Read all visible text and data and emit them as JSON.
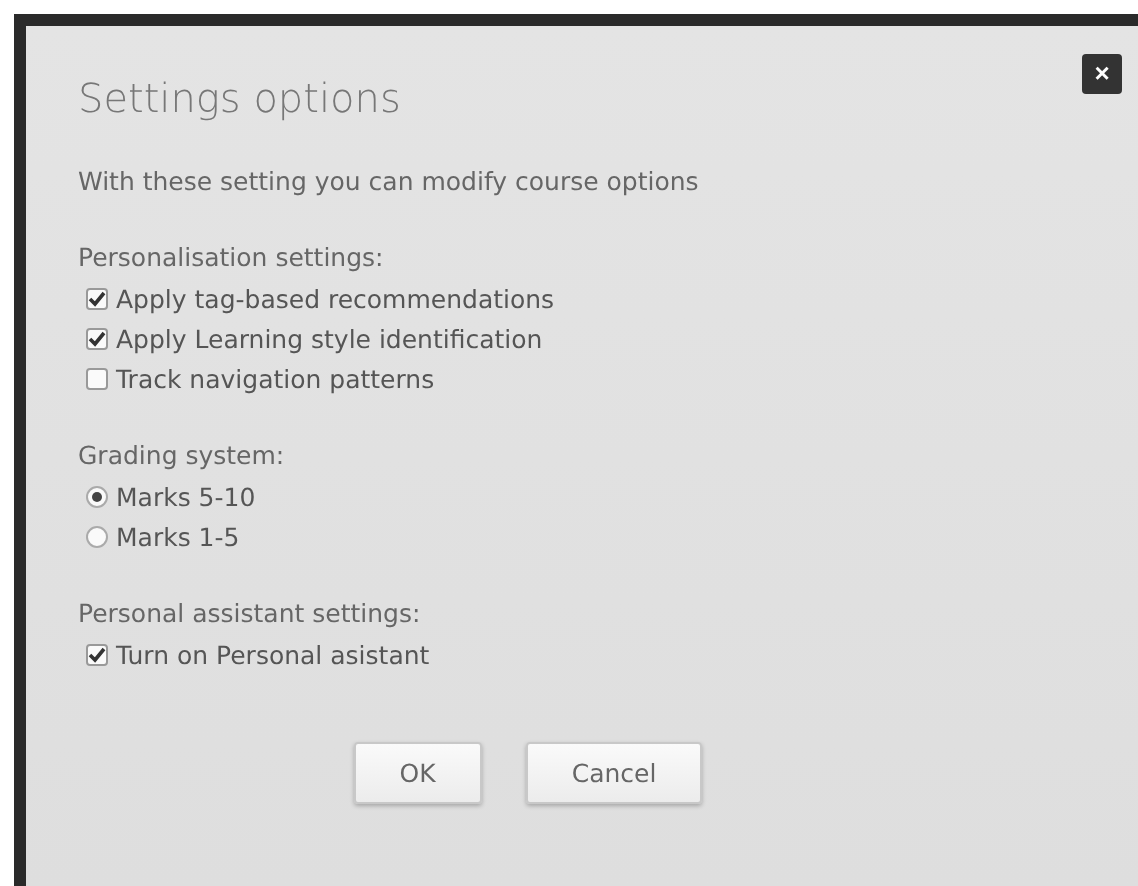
{
  "dialog": {
    "title": "Settings options",
    "close": "×",
    "description": "With these setting you can modify course options",
    "sections": [
      {
        "heading": "Personalisation settings:",
        "options": [
          {
            "kind": "checkbox",
            "label": "Apply tag-based recommendations",
            "checked": true
          },
          {
            "kind": "checkbox",
            "label": "Apply Learning style identification",
            "checked": true
          },
          {
            "kind": "checkbox",
            "label": "Track navigation patterns",
            "checked": false
          }
        ]
      },
      {
        "heading": "Grading system:",
        "options": [
          {
            "kind": "radio",
            "label": "Marks 5-10",
            "selected": true
          },
          {
            "kind": "radio",
            "label": "Marks 1-5",
            "selected": false
          }
        ]
      },
      {
        "heading": "Personal assistant settings:",
        "options": [
          {
            "kind": "checkbox",
            "label": "Turn on Personal asistant",
            "checked": true
          }
        ]
      }
    ],
    "buttons": [
      "OK",
      "Cancel"
    ]
  }
}
